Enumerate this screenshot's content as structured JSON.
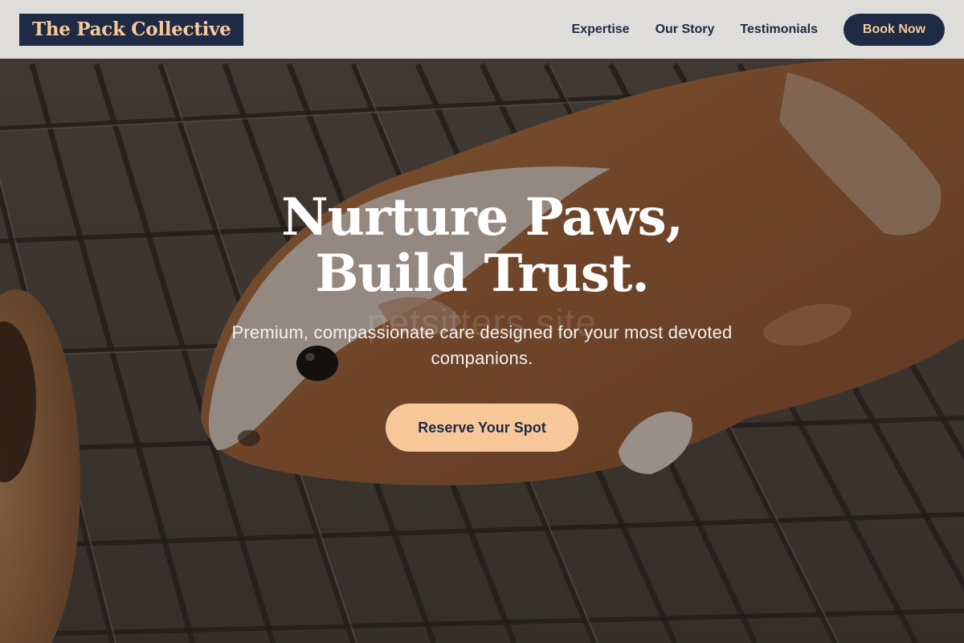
{
  "header": {
    "logo_text": "The Pack Collective",
    "nav_items": [
      "Expertise",
      "Our Story",
      "Testimonials"
    ],
    "book_label": "Book Now"
  },
  "hero": {
    "title_line1": "Nurture Paws,",
    "title_line2": "Build Trust.",
    "subtitle": "Premium, compassionate care designed for your most devoted companions.",
    "cta_label": "Reserve Your Spot",
    "watermark": "petsitters site",
    "image_subject": "guinea pig on metal wire grate"
  },
  "colors": {
    "navy": "#1f2a44",
    "peach": "#f8c89b",
    "header_bg": "#ece9e6",
    "guinea_pig_brown": "#a8673a",
    "guinea_pig_white": "#eae4de"
  }
}
